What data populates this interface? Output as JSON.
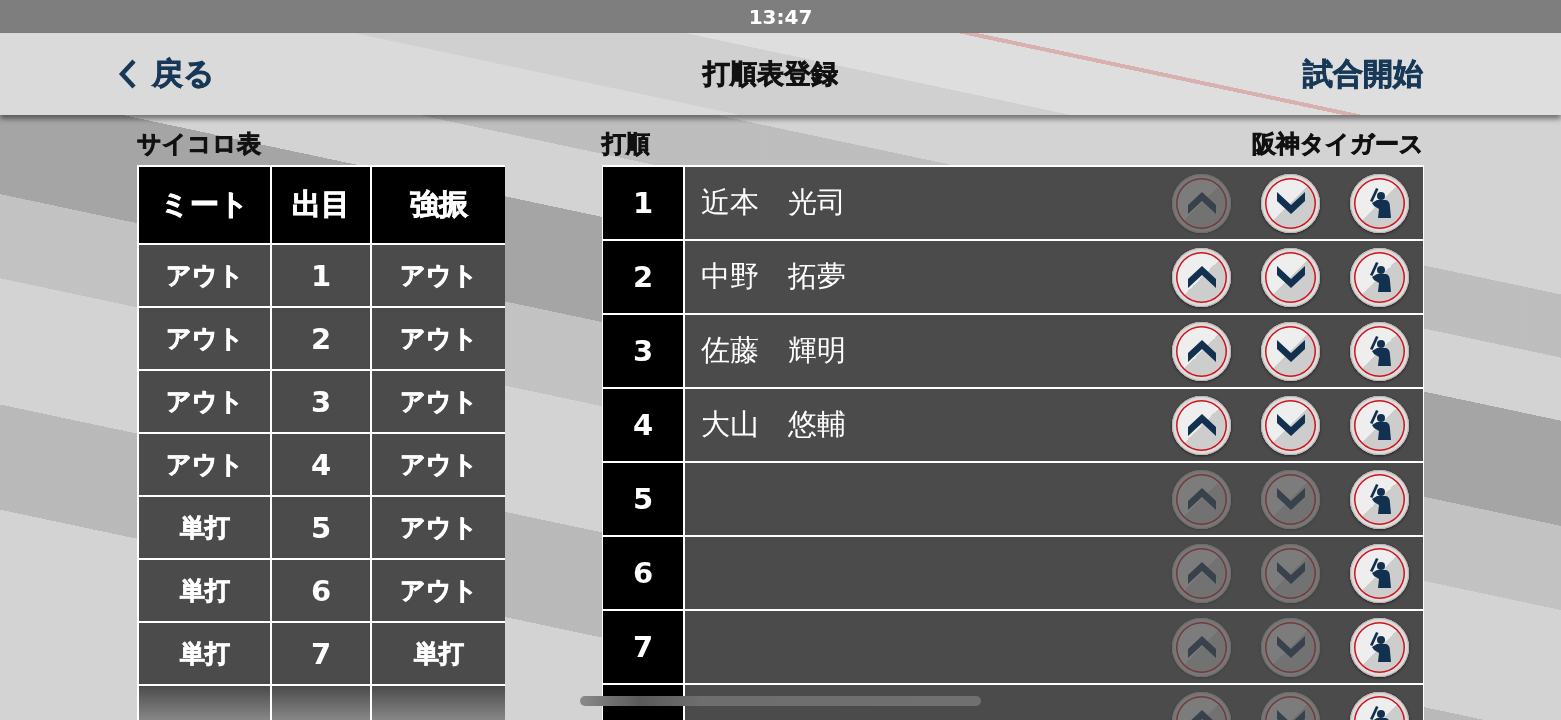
{
  "status_bar": {
    "time": "13:47"
  },
  "nav_bar": {
    "back_label": "戻る",
    "title": "打順表登録",
    "action": "試合開始"
  },
  "dice_table": {
    "title": "サイコロ表",
    "columns": [
      "ミート",
      "出目",
      "強振"
    ],
    "rows": [
      [
        "アウト",
        "1",
        "アウト"
      ],
      [
        "アウト",
        "2",
        "アウト"
      ],
      [
        "アウト",
        "3",
        "アウト"
      ],
      [
        "アウト",
        "4",
        "アウト"
      ],
      [
        "単打",
        "5",
        "アウト"
      ],
      [
        "単打",
        "6",
        "アウト"
      ],
      [
        "単打",
        "7",
        "単打"
      ]
    ]
  },
  "batting_order": {
    "title": "打順",
    "team": "阪神タイガース",
    "rows": [
      {
        "number": "1",
        "player": "近本　光司",
        "move_up_disabled": true,
        "move_down_disabled": false
      },
      {
        "number": "2",
        "player": "中野　拓夢",
        "move_up_disabled": false,
        "move_down_disabled": false
      },
      {
        "number": "3",
        "player": "佐藤　輝明",
        "move_up_disabled": false,
        "move_down_disabled": false
      },
      {
        "number": "4",
        "player": "大山　悠輔",
        "move_up_disabled": false,
        "move_down_disabled": false
      },
      {
        "number": "5",
        "move_up_disabled": true,
        "move_down_disabled": true
      },
      {
        "number": "6",
        "move_up_disabled": true,
        "move_down_disabled": true
      },
      {
        "number": "7",
        "move_up_disabled": true,
        "move_down_disabled": true
      },
      {
        "move_up_disabled": true,
        "move_down_disabled": true
      }
    ]
  }
}
